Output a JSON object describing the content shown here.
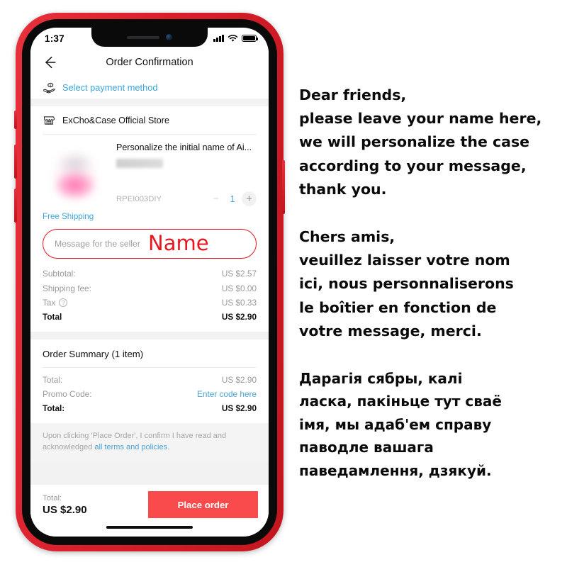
{
  "phone": {
    "status_bar": {
      "time": "1:37",
      "signal_icon": "signal-bars-icon",
      "wifi_icon": "wifi-icon",
      "battery_icon": "battery-full-icon"
    },
    "notch": {
      "speaker_icon": "earpiece-speaker-icon",
      "camera_icon": "front-camera-icon"
    },
    "side_buttons": {
      "mute": "silent-switch",
      "volume_up": "volume-up-button",
      "volume_down": "volume-down-button",
      "power": "power-button"
    },
    "home_indicator": "home-indicator"
  },
  "nav": {
    "back_icon": "back-arrow-icon",
    "title": "Order Confirmation"
  },
  "payment": {
    "icon": "hand-holding-money-icon",
    "label": "Select payment method",
    "link_color": "#3ba7d9"
  },
  "store": {
    "icon": "storefront-icon",
    "name": "ExCho&Case Official Store"
  },
  "product": {
    "thumb_icon": "product-thumbnail-blurred",
    "title": "Personalize the initial name of Ai...",
    "variant": "",
    "sku": "RPEI003DIY",
    "quantity": "1",
    "minus_label": "−",
    "plus_label": "+",
    "shipping_badge": "Free Shipping"
  },
  "message_field": {
    "placeholder": "Message for the seller",
    "value": "",
    "annotation": "Name",
    "border_color": "#e8161f"
  },
  "fees": {
    "rows": [
      {
        "label": "Subtotal:",
        "value": "US $2.57"
      },
      {
        "label": "Shipping fee:",
        "value": "US $0.00"
      },
      {
        "label": "Tax",
        "value": "US $0.33",
        "help_icon": "question-mark-icon"
      },
      {
        "label": "Total",
        "value": "US $2.90"
      }
    ]
  },
  "order_summary": {
    "title": "Order Summary (1 item)",
    "rows": [
      {
        "label": "Total:",
        "value": "US $2.90"
      },
      {
        "label": "Promo Code:",
        "value": "Enter code here"
      },
      {
        "label": "Total:",
        "value": "US $2.90"
      }
    ]
  },
  "terms": {
    "text_before": "Upon clicking 'Place Order', I confirm I have read and acknowledged ",
    "link": "all terms and policies",
    "text_after": "."
  },
  "checkout": {
    "total_label": "Total:",
    "total_value": "US $2.90",
    "button_label": "Place order",
    "button_color": "#f94b4b"
  },
  "notes": {
    "english": [
      "Dear friends,",
      "please leave your name here,",
      "we will personalize the case",
      "according to your message,",
      "thank you."
    ],
    "french": [
      "Chers amis,",
      "veuillez laisser votre nom",
      "ici, nous personnaliserons",
      "le boîtier en fonction de",
      "votre message, merci."
    ],
    "belarusian": [
      "Дарагія сябры, калі",
      "ласка, пакіньце тут сваё",
      "імя, мы адаб'ем справу",
      "паводле вашага",
      "паведамлення, дзякуй."
    ]
  }
}
